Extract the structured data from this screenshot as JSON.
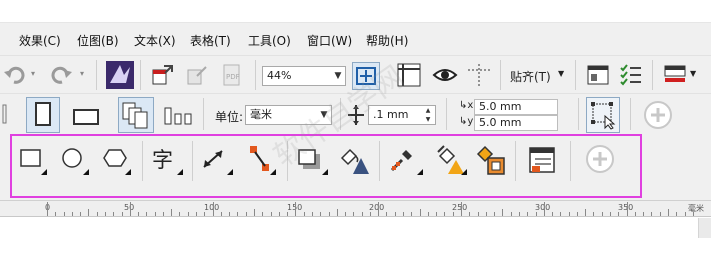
{
  "menu": {
    "items": [
      {
        "label": "效果(C)"
      },
      {
        "label": "位图(B)"
      },
      {
        "label": "文本(X)"
      },
      {
        "label": "表格(T)"
      },
      {
        "label": "工具(O)"
      },
      {
        "label": "窗口(W)"
      },
      {
        "label": "帮助(H)"
      }
    ]
  },
  "toolbar_standard": {
    "zoom_value": "44%",
    "snap_label": "贴齐(T)"
  },
  "toolbar_property": {
    "unit_label": "单位:",
    "unit_value": "毫米",
    "nudge_value": ".1 mm",
    "dup_x": "5.0 mm",
    "dup_y": "5.0 mm"
  },
  "ruler": {
    "ticks": [
      "0",
      "50",
      "100",
      "150",
      "200",
      "250",
      "300",
      "350"
    ],
    "unit": "毫米"
  },
  "icons": {
    "rectangle": "rectangle-tool-icon",
    "ellipse": "ellipse-tool-icon",
    "polygon": "polygon-tool-icon",
    "text": "text-tool-icon",
    "dimension": "dimension-tool-icon",
    "connector": "connector-tool-icon",
    "drop_shadow": "drop-shadow-tool-icon",
    "transparency": "transparency-tool-icon",
    "eyedropper": "color-eyedropper-icon",
    "fill": "interactive-fill-icon",
    "smart_fill": "smart-fill-icon",
    "mesh": "object-properties-icon",
    "add": "add-tool-icon"
  },
  "text_tool_glyph": "字",
  "watermark": "软件自学网",
  "colors": {
    "highlight": "#e040e0",
    "toolbar_bg": "#f0f0f0"
  }
}
